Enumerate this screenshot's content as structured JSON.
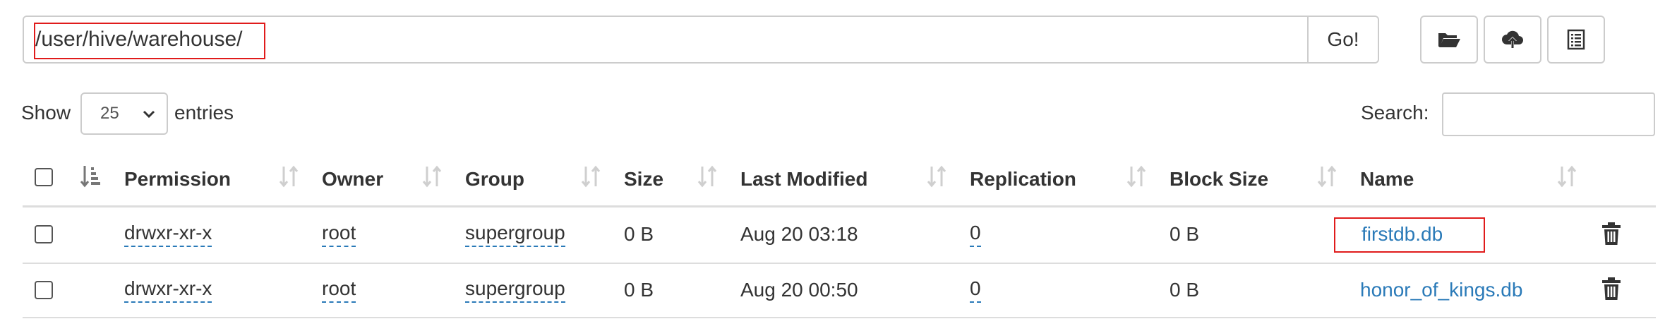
{
  "path_bar": {
    "value": "/user/hive/warehouse/",
    "go_label": "Go!"
  },
  "toolbar": {
    "buttons": [
      {
        "icon": "folder-open-icon"
      },
      {
        "icon": "cloud-upload-icon"
      },
      {
        "icon": "list-icon"
      }
    ]
  },
  "entries": {
    "show_label": "Show",
    "selected": "25",
    "suffix_label": "entries"
  },
  "search": {
    "label": "Search:",
    "value": ""
  },
  "table": {
    "columns": [
      "Permission",
      "Owner",
      "Group",
      "Size",
      "Last Modified",
      "Replication",
      "Block Size",
      "Name"
    ],
    "rows": [
      {
        "permission": "drwxr-xr-x",
        "owner": "root",
        "group": "supergroup",
        "size": "0 B",
        "last_modified": "Aug 20 03:18",
        "replication": "0",
        "block_size": "0 B",
        "name": "firstdb.db"
      },
      {
        "permission": "drwxr-xr-x",
        "owner": "root",
        "group": "supergroup",
        "size": "0 B",
        "last_modified": "Aug 20 00:50",
        "replication": "0",
        "block_size": "0 B",
        "name": "honor_of_kings.db"
      }
    ]
  },
  "colors": {
    "link": "#2a7ab8",
    "highlight": "#e01b1b",
    "border": "#cccccc"
  }
}
